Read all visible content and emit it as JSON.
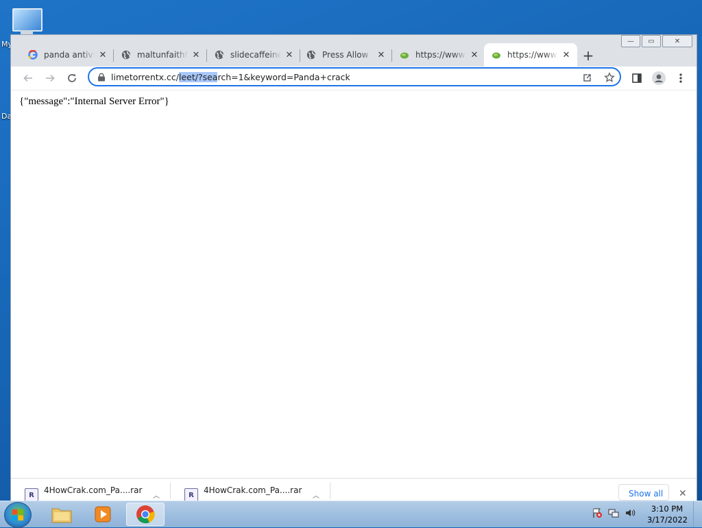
{
  "desktop": {
    "labels": [
      "My",
      "Da"
    ]
  },
  "window": {
    "controls": {
      "minimize": "—",
      "maximize": "▭",
      "close": "✕"
    }
  },
  "tabs": [
    {
      "title": "panda antivirus",
      "favicon": "google-icon",
      "active": false
    },
    {
      "title": "maltunfaithful",
      "favicon": "globe-icon",
      "active": false
    },
    {
      "title": "slidecaffeine",
      "favicon": "globe-icon",
      "active": false
    },
    {
      "title": "Press Allow",
      "favicon": "globe-icon",
      "active": false
    },
    {
      "title": "https://www.lime",
      "favicon": "lime-icon",
      "active": false
    },
    {
      "title": "https://www.lime",
      "favicon": "lime-icon",
      "active": true
    }
  ],
  "new_tab_label": "+",
  "omnibox": {
    "url_before": "limetorrentx.cc/",
    "url_selected": "leet/?sea",
    "url_after": "rch=1&keyword=Panda+crack"
  },
  "page": {
    "body_text": "{\"message\":\"Internal Server Error\"}"
  },
  "downloads": {
    "items": [
      {
        "name": "4HowCrak.com_Pa....rar",
        "icon": "winrar-icon"
      },
      {
        "name": "4HowCrak.com_Pa....rar",
        "icon": "winrar-icon"
      }
    ],
    "show_all_label": "Show all",
    "close_label": "✕"
  },
  "taskbar": {
    "apps": [
      "file-explorer",
      "media-player",
      "chrome"
    ],
    "clock_time": "3:10 PM",
    "clock_date": "3/17/2022"
  },
  "colors": {
    "accent": "#1a73e8",
    "selection": "#a8c7fa",
    "tab_strip": "#dee1e6"
  }
}
